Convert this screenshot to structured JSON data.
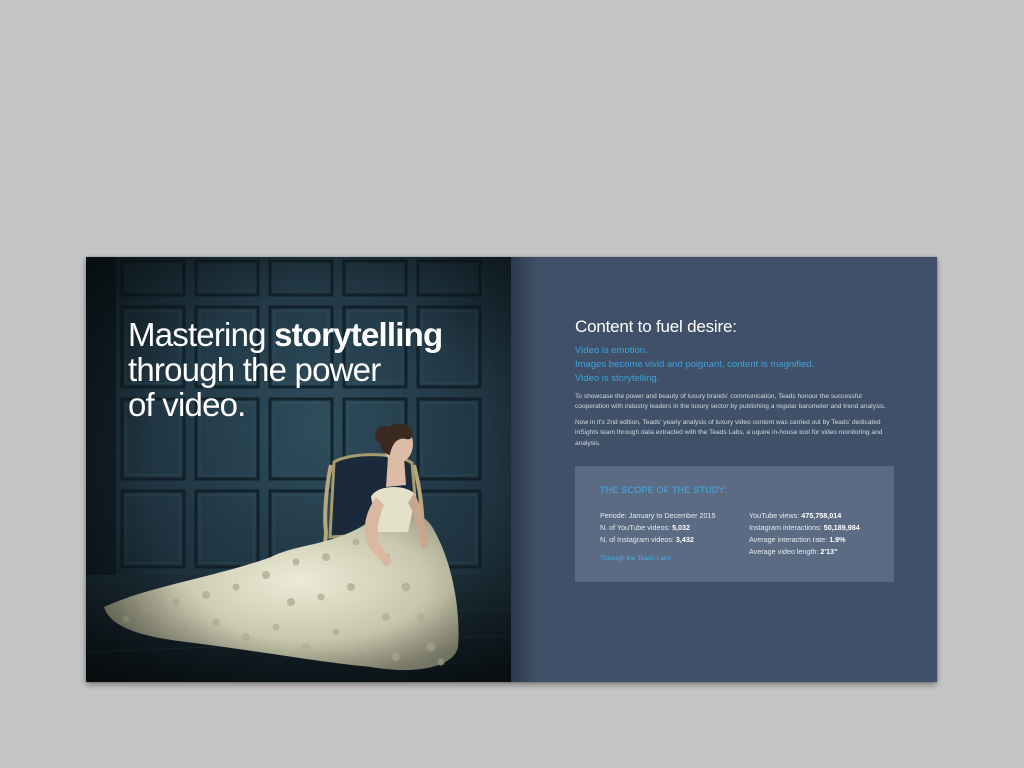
{
  "left_page": {
    "headline": {
      "line1_normal": "Mastering ",
      "line1_bold": "storytelling",
      "line2": "through the power",
      "line3": "of video."
    }
  },
  "right_page": {
    "title": "Content to fuel desire:",
    "highlights": [
      "Video is emotion.",
      "Images become vivid and poignant, content is magnified.",
      "Video is storytelling."
    ],
    "paragraph1": "To showcase the power and beauty of luxury brands' communication, Teads honour the successful cooperation with industry leaders in the luxury sector by publishing a regular barometer and trend analysis.",
    "paragraph2": "Now in it's 2nd edition, Teads' yearly analysis of luxury video content was carried out by Teads' dedicated inSights team through data extracted with the Teads Labs, a uquire in-house tool for video monitoring and analysis.",
    "scope": {
      "title": "THE SCOPE OF THE STUDY:",
      "left_stats": [
        {
          "label": "Periode: January to December 2015",
          "value": ""
        },
        {
          "label": "N. of YouTube videos: ",
          "value": "5,032"
        },
        {
          "label": "N. of Instagram videos: ",
          "value": "3,432"
        }
      ],
      "right_stats": [
        {
          "label": "YouTube views: ",
          "value": "475,758,014"
        },
        {
          "label": "Instagram interactions: ",
          "value": "50,189,984"
        },
        {
          "label": "Average interaction rate: ",
          "value": "1.9%"
        },
        {
          "label": "Average video length: ",
          "value": "2'13\""
        }
      ],
      "link": "Through the Teads Labs"
    }
  },
  "colors": {
    "background": "#c5c5c5",
    "right_page": "#3f5068",
    "scope_box": "#5b6b83",
    "accent_blue": "#3ca6dd",
    "panel_wall": "#1e3440"
  }
}
